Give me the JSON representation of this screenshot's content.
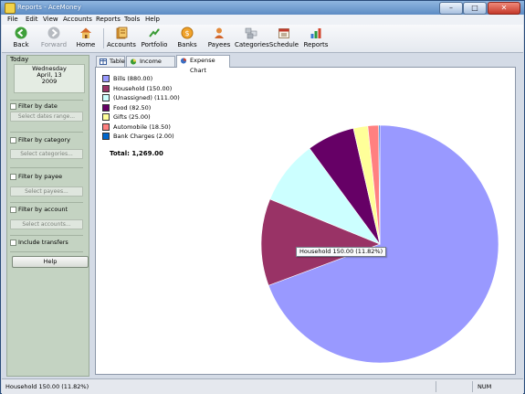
{
  "window": {
    "title": "Reports - AceMoney"
  },
  "menu": [
    "File",
    "Edit",
    "View",
    "Accounts",
    "Reports",
    "Tools",
    "Help"
  ],
  "toolbar": {
    "back": "Back",
    "forward": "Forward",
    "home": "Home",
    "accounts": "Accounts",
    "portfolio": "Portfolio",
    "banks": "Banks",
    "payees": "Payees",
    "categories": "Categories",
    "schedule": "Schedule",
    "reports": "Reports"
  },
  "sidebar": {
    "today_label": "Today",
    "today_day": "Wednesday",
    "today_date": "April, 13",
    "today_year": "2009",
    "filter_date_label": "Filter by date",
    "filter_date_button": "Select dates range...",
    "filter_category_label": "Filter by category",
    "filter_category_button": "Select categories...",
    "filter_payee_label": "Filter by payee",
    "filter_payee_button": "Select payees...",
    "filter_account_label": "Filter by account",
    "filter_account_button": "Select accounts...",
    "include_transfers_label": "Include transfers",
    "help_button": "Help"
  },
  "tabs": {
    "table": "Table",
    "income_chart": "Income Chart",
    "expense_chart": "Expense Chart"
  },
  "chart_data": {
    "type": "pie",
    "categories": [
      "Bills",
      "Household",
      "(Unassigned)",
      "Food",
      "Gifts",
      "Automobile",
      "Bank Charges"
    ],
    "values": [
      880.0,
      150.0,
      111.0,
      82.5,
      25.0,
      18.5,
      2.0
    ],
    "legend_labels": [
      "Bills (880.00)",
      "Household (150.00)",
      "(Unassigned) (111.00)",
      "Food (82.50)",
      "Gifts (25.00)",
      "Automobile (18.50)",
      "Bank Charges (2.00)"
    ],
    "colors": [
      "#9999ff",
      "#993366",
      "#ccffff",
      "#660066",
      "#ffff99",
      "#ff8080",
      "#0066cc"
    ],
    "total_label": "Total:  1,269.00",
    "tooltip": "Household 150.00 (11.82%)",
    "legend_position": "top-left"
  },
  "status": {
    "text": "Household 150.00 (11.82%)",
    "num": "NUM"
  }
}
